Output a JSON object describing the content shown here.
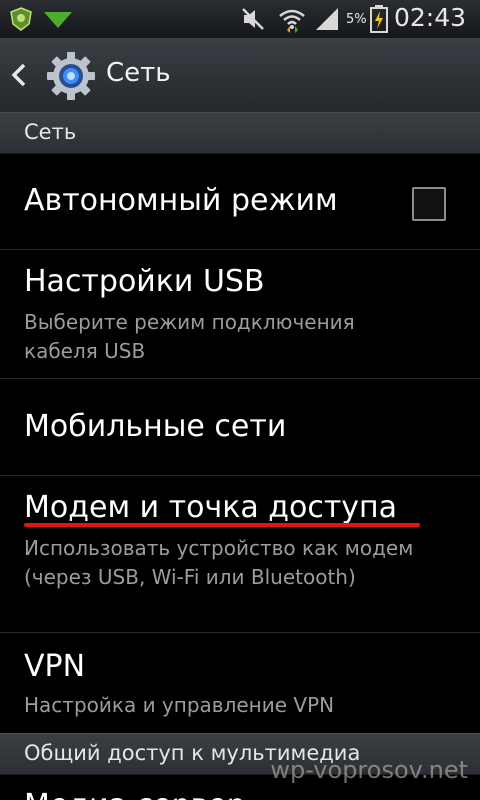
{
  "status_bar": {
    "time": "02:43",
    "battery_percent": "5%",
    "icons": [
      "app-shield-icon",
      "download-arrow-icon",
      "mute-icon",
      "wifi-icon",
      "signal-icon",
      "battery-charging-icon"
    ]
  },
  "action_bar": {
    "title": "Сеть",
    "app_icon": "settings-gear-icon",
    "back_icon": "chevron-left-icon"
  },
  "sections": [
    {
      "label": "Сеть"
    },
    {
      "label": "Общий доступ к мультимедиа"
    }
  ],
  "items": [
    {
      "title": "Автономный режим",
      "checked": false
    },
    {
      "title": "Настройки USB",
      "subtitle": "Выберите режим подключения кабеля USB"
    },
    {
      "title": "Мобильные сети"
    },
    {
      "title": "Модем и точка доступа",
      "subtitle": "Использовать устройство как модем (через USB, Wi-Fi или Bluetooth)",
      "highlighted": true
    },
    {
      "title": "VPN",
      "subtitle": "Настройка и управление VPN"
    },
    {
      "title": "Медиа сервер"
    }
  ],
  "watermark": "wp-voprosov.net",
  "colors": {
    "highlight_underline": "#e01515",
    "background": "#000000",
    "subtitle_text": "#9c9c9c"
  }
}
